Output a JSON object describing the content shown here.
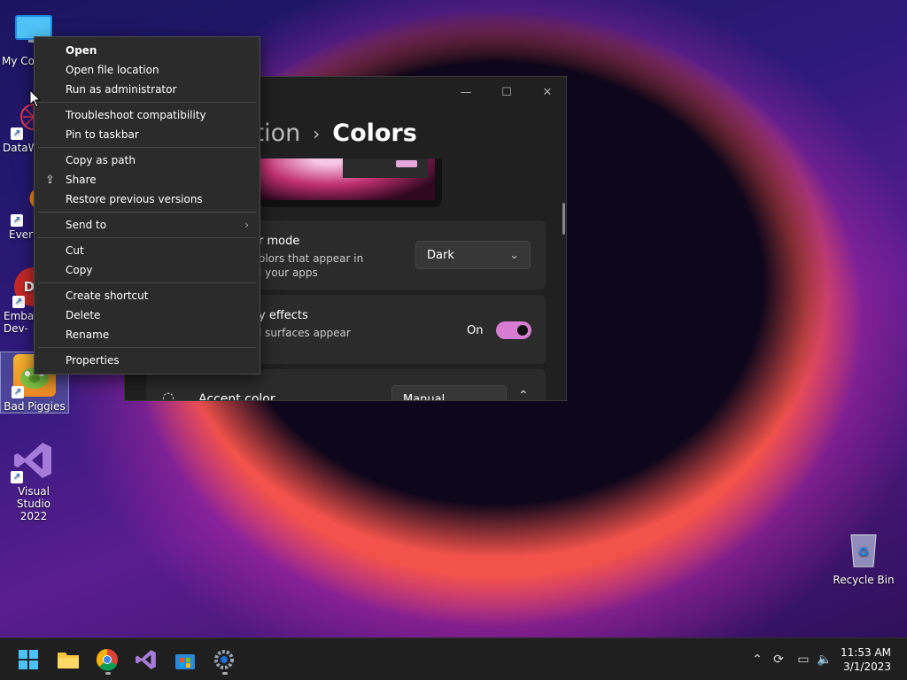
{
  "desktop": {
    "icons": [
      {
        "label": "My Co",
        "icon": "monitor-icon"
      },
      {
        "label": "DataW",
        "icon": "datawiz-icon"
      },
      {
        "label": "Every",
        "icon": "everything-search-icon"
      },
      {
        "label": "Embar Dev-",
        "icon": "embarcadero-icon"
      },
      {
        "label": "Bad Piggies",
        "icon": "bad-piggies-icon"
      },
      {
        "label": "Visual Studio 2022",
        "icon": "visual-studio-icon"
      },
      {
        "label": "Recycle Bin",
        "icon": "recycle-bin-icon"
      }
    ]
  },
  "settings": {
    "breadcrumb_parent": "ation",
    "breadcrumb_current": "Colors",
    "mode_title": "r mode",
    "mode_desc_1": "olors that appear in",
    "mode_desc_2": "l your apps",
    "mode_value": "Dark",
    "effects_title": "y effects",
    "effects_desc": "l surfaces appear",
    "effects_state": "On",
    "accent_title": "Accent color",
    "accent_value": "Manual",
    "toggle_color": "#d77cd0"
  },
  "context_menu": {
    "items": [
      {
        "label": "Open",
        "bold": true
      },
      {
        "label": "Open file location"
      },
      {
        "label": "Run as administrator"
      },
      {
        "label": "Troubleshoot compatibility"
      },
      {
        "label": "Pin to taskbar"
      },
      {
        "label": "Copy as path"
      },
      {
        "label": "Share",
        "icon": "share-icon"
      },
      {
        "label": "Restore previous versions"
      },
      {
        "label": "Send to",
        "submenu": true
      },
      {
        "label": "Cut"
      },
      {
        "label": "Copy"
      },
      {
        "label": "Create shortcut"
      },
      {
        "label": "Delete"
      },
      {
        "label": "Rename"
      },
      {
        "label": "Properties"
      }
    ]
  },
  "taskbar": {
    "apps": [
      "start-icon",
      "file-explorer-icon",
      "chrome-icon",
      "visual-studio-icon",
      "store-icon",
      "settings-icon"
    ],
    "time": "11:53 AM",
    "date": "3/1/2023"
  }
}
